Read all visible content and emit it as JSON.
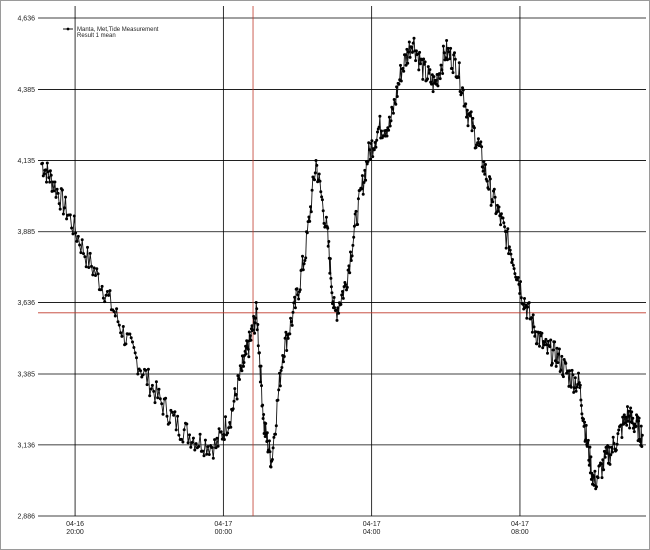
{
  "chart_data": {
    "type": "line",
    "legend": {
      "line1": "Manta, Met,Tide Measurement",
      "line2": "Result 1 mean",
      "placement": "top-left"
    },
    "y_ticks": [
      "4,636",
      "4,385",
      "4,135",
      "3,885",
      "3,636",
      "3,385",
      "3,136",
      "2,886"
    ],
    "y_tick_values": [
      4636,
      4385,
      4135,
      3885,
      3636,
      3385,
      3136,
      2886
    ],
    "ylim": [
      2886,
      4636
    ],
    "x_ticks": [
      {
        "date": "04-16",
        "time": "20:00",
        "hour": 20
      },
      {
        "date": "04-17",
        "time": "00:00",
        "hour": 24
      },
      {
        "date": "04-17",
        "time": "04:00",
        "hour": 28
      },
      {
        "date": "04-17",
        "time": "08:00",
        "hour": 32
      }
    ],
    "xlim_hours": [
      19.0,
      35.4
    ],
    "cursor": {
      "hour": 24.8,
      "value": 3600
    },
    "grid": true,
    "colors": {
      "line": "#111111",
      "marker": "#000000",
      "grid": "#000000",
      "cursor": "#c0392b"
    },
    "series": [
      {
        "x": [
          19.1,
          19.4,
          19.8,
          20.3,
          20.8,
          21.3,
          21.8,
          22.3,
          22.8,
          23.3,
          23.8,
          24.2,
          24.5,
          24.7,
          24.9,
          25.1,
          25.3,
          25.6,
          25.9,
          26.2,
          26.5,
          26.8,
          27.0,
          27.3,
          27.6,
          27.9,
          28.2,
          28.5,
          28.8,
          29.1,
          29.4,
          29.7,
          30.0,
          30.3,
          30.6,
          30.9,
          31.2,
          31.5,
          31.8,
          32.1,
          32.4,
          32.7,
          33.0,
          33.3,
          33.6,
          33.8,
          34.0,
          34.3,
          34.6,
          34.9,
          35.1,
          35.3
        ],
        "y": [
          4125,
          4060,
          3950,
          3800,
          3680,
          3530,
          3400,
          3290,
          3200,
          3150,
          3130,
          3240,
          3400,
          3490,
          3600,
          3200,
          3080,
          3460,
          3600,
          3800,
          4130,
          3880,
          3590,
          3700,
          3940,
          4150,
          4250,
          4260,
          4450,
          4560,
          4450,
          4400,
          4520,
          4470,
          4300,
          4180,
          4030,
          3920,
          3800,
          3650,
          3540,
          3470,
          3450,
          3380,
          3350,
          3150,
          3000,
          3080,
          3150,
          3240,
          3210,
          3170
        ]
      }
    ]
  }
}
